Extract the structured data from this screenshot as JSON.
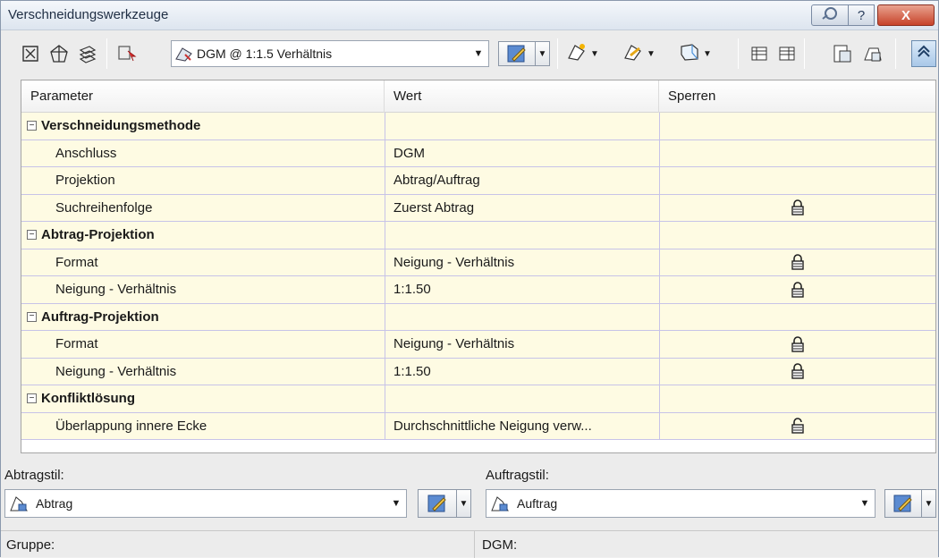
{
  "window": {
    "title": "Verschneidungswerkzeuge",
    "title_buttons": [
      "pin-icon",
      "help-icon",
      "close-icon"
    ],
    "help_label": "?",
    "close_label": "X"
  },
  "toolbar": {
    "icons_left": [
      "set-surface-icon",
      "set-group-icon",
      "select-layers-icon",
      "target-surface-icon"
    ],
    "criteria_combo": {
      "icon": "grading-criteria-icon",
      "value": "DGM @ 1:1.5 Verhältnis"
    },
    "icons_right": [
      "edit-criteria-icon",
      "create-grading-icon",
      "edit-grading-icon",
      "create-volume-icon",
      "grading-volume-tools-icon",
      "grading-editor-icon",
      "elevation-editor-icon",
      "expand-icon"
    ]
  },
  "grid": {
    "columns": [
      "Parameter",
      "Wert",
      "Sperren"
    ],
    "rows": [
      {
        "type": "group",
        "parameter": "Verschneidungsmethode",
        "value": "",
        "locked": false
      },
      {
        "type": "item",
        "parameter": "Anschluss",
        "value": "DGM",
        "locked": false
      },
      {
        "type": "item",
        "parameter": "Projektion",
        "value": "Abtrag/Auftrag",
        "locked": false
      },
      {
        "type": "item",
        "parameter": "Suchreihenfolge",
        "value": "Zuerst Abtrag",
        "locked": true
      },
      {
        "type": "group",
        "parameter": "Abtrag-Projektion",
        "value": "",
        "locked": false
      },
      {
        "type": "item",
        "parameter": "Format",
        "value": "Neigung - Verhältnis",
        "locked": true
      },
      {
        "type": "item",
        "parameter": "Neigung - Verhältnis",
        "value": "1:1.50",
        "locked": true
      },
      {
        "type": "group",
        "parameter": "Auftrag-Projektion",
        "value": "",
        "locked": false
      },
      {
        "type": "item",
        "parameter": "Format",
        "value": "Neigung - Verhältnis",
        "locked": true
      },
      {
        "type": "item",
        "parameter": "Neigung - Verhältnis",
        "value": "1:1.50",
        "locked": true
      },
      {
        "type": "group",
        "parameter": "Konfliktlösung",
        "value": "",
        "locked": false
      },
      {
        "type": "item",
        "parameter": "Überlappung innere Ecke",
        "value": "Durchschnittliche Neigung verw...",
        "locked": "open"
      }
    ],
    "expander_symbol": "⊟"
  },
  "styles": {
    "cut_label": "Abtragstil:",
    "cut_value": "Abtrag",
    "fill_label": "Auftragstil:",
    "fill_value": "Auftrag"
  },
  "status": {
    "group_label": "Gruppe:",
    "surface_label": "DGM:"
  },
  "colors": {
    "row_background": "#fefbe3",
    "grid_lines": "#c7c3e8",
    "close_button": "#c7432a"
  }
}
